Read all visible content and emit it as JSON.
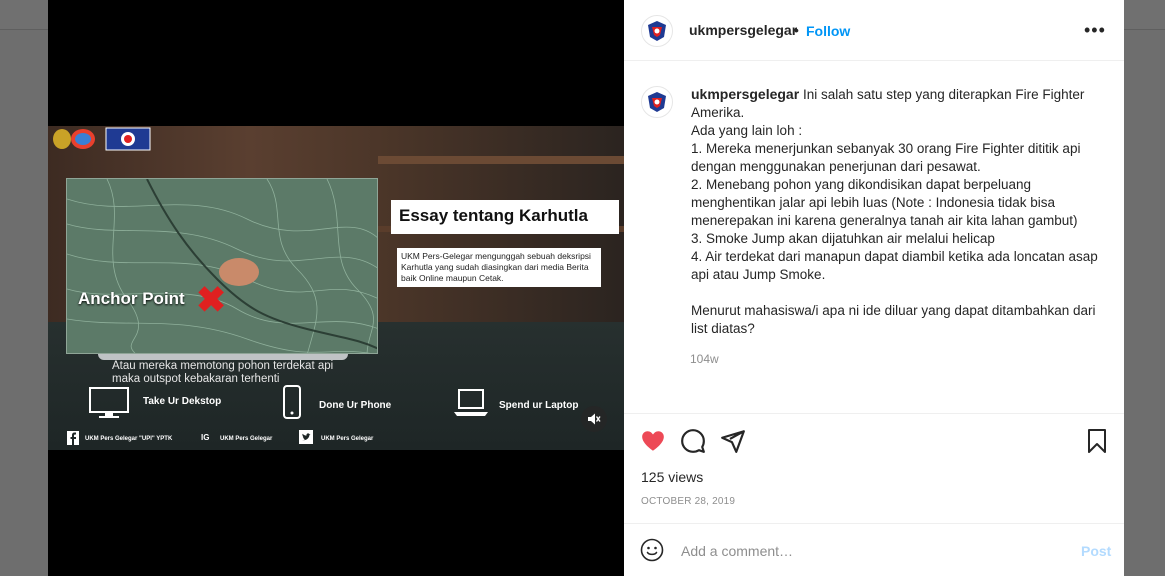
{
  "post": {
    "username": "ukmpersgelegar",
    "separator": "•",
    "follow_label": "Follow",
    "more_label": "•••",
    "caption_lines": [
      "Ini salah satu step yang diterapkan Fire Fighter Amerika.",
      "Ada yang lain loh :",
      "1. Mereka menerjunkan sebanyak 30 orang Fire Fighter dititik api dengan menggunakan penerjunan dari pesawat.",
      "2. Menebang pohon yang dikondisikan dapat berpeluang menghentikan jalar api lebih luas (Note : Indonesia tidak bisa menerepakan ini karena generalnya tanah air kita lahan gambut)",
      "3. Smoke Jump akan dijatuhkan air melalui helicap",
      "4. Air terdekat dari manapun dapat diambil ketika ada loncatan asap api atau Jump Smoke."
    ],
    "question": "Menurut mahasiswa/i apa ni ide diluar yang dapat ditambahkan dari list diatas?",
    "time_ago": "104w",
    "views": "125 views",
    "date": "OCTOBER 28, 2019",
    "comment_placeholder": "Add a comment…",
    "post_label": "Post"
  },
  "video": {
    "anchor_label": "Anchor Point",
    "essay_title": "Essay tentang Karhutla",
    "essay_desc": "UKM Pers-Gelegar mengunggah sebuah deksripsi Karhutla yang sudah diasingkan dari media Berita baik Online maupun Cetak.",
    "caption_line1": "Atau mereka memotong pohon terdekat api",
    "caption_line2": "maka outspot kebakaran terhenti",
    "device1": "Take Ur Dekstop",
    "device2": "Done Ur Phone",
    "device3": "Spend ur Laptop",
    "social1": "UKM Pers Gelegar \"UPI\" YPTK",
    "social_ig": "IG",
    "social2": "UKM Pers Gelegar",
    "social3": "UKM Pers Gelegar"
  },
  "icons": {
    "heart_color": "#ed4956",
    "follow_color": "#0095f6"
  }
}
